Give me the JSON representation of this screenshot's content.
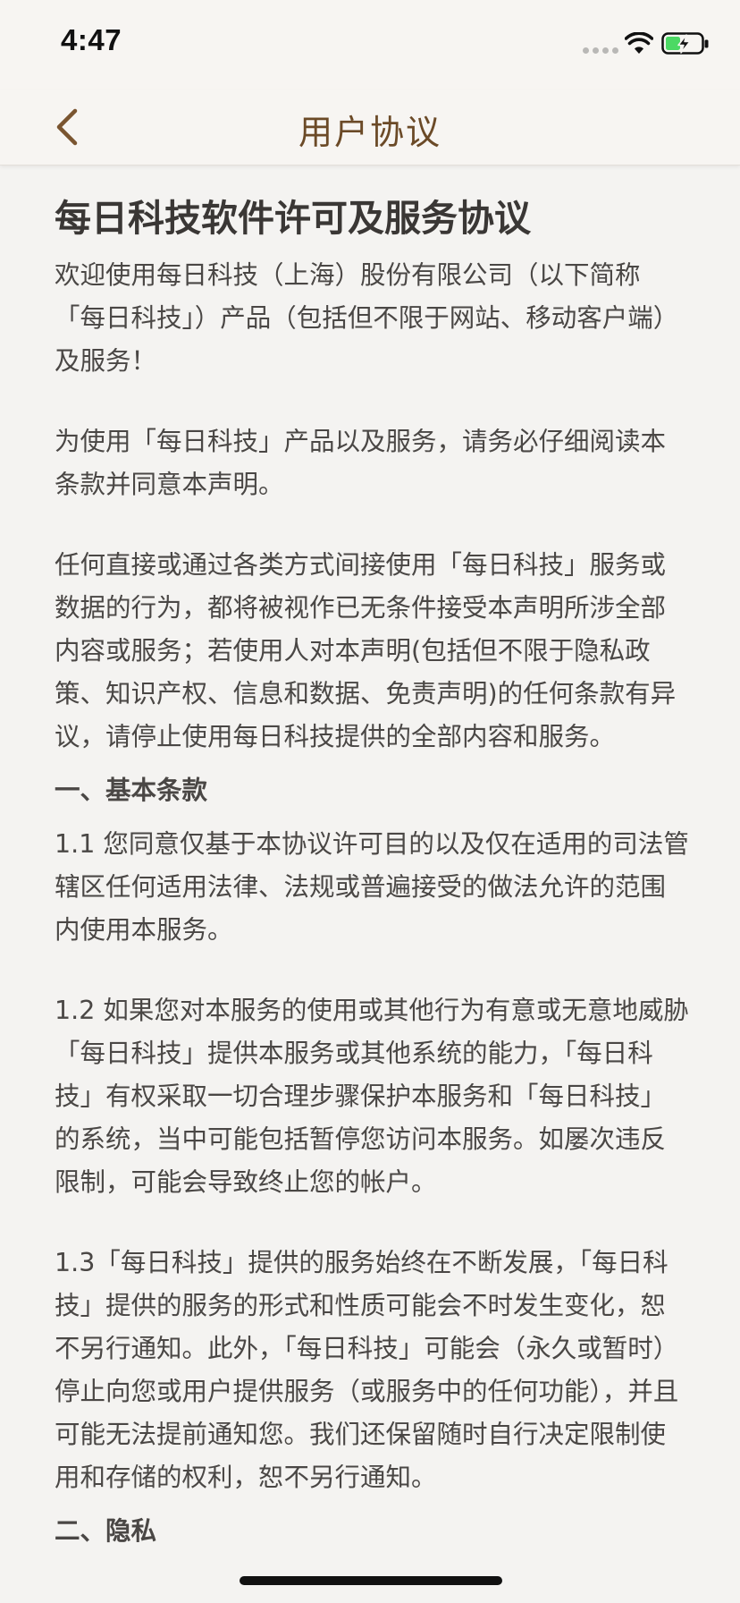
{
  "status_bar": {
    "time": "4:47"
  },
  "nav": {
    "title": "用户协议"
  },
  "document": {
    "title": "每日科技软件许可及服务协议",
    "intro_1": "欢迎使用每日科技（上海）股份有限公司（以下简称「每日科技」）产品（包括但不限于网站、移动客户端）及服务！",
    "intro_2": "为使用「每日科技」产品以及服务，请务必仔细阅读本条款并同意本声明。",
    "intro_3": "任何直接或通过各类方式间接使用「每日科技」服务或数据的行为，都将被视作已无条件接受本声明所涉全部内容或服务；若使用人对本声明(包括但不限于隐私政策、知识产权、信息和数据、免责声明)的任何条款有异议，请停止使用每日科技提供的全部内容和服务。",
    "section_1_heading": "一、基本条款",
    "clause_1_1": "1.1 您同意仅基于本协议许可目的以及仅在适用的司法管辖区任何适用法律、法规或普遍接受的做法允许的范围内使用本服务。",
    "clause_1_2": "1.2 如果您对本服务的使用或其他行为有意或无意地威胁「每日科技」提供本服务或其他系统的能力，「每日科技」有权采取一切合理步骤保护本服务和「每日科技」的系统，当中可能包括暂停您访问本服务。如屡次违反限制，可能会导致终止您的帐户。",
    "clause_1_3": "1.3「每日科技」提供的服务始终在不断发展，「每日科技」提供的服务的形式和性质可能会不时发生变化，恕不另行通知。此外，「每日科技」可能会（永久或暂时）停止向您或用户提供服务（或服务中的任何功能），并且可能无法提前通知您。我们还保留随时自行决定限制使用和存储的权利，恕不另行通知。",
    "section_2_heading": "二、隐私"
  },
  "colors": {
    "nav_title": "#6b4a27",
    "back_icon": "#7a5530",
    "battery_fill": "#4cd964"
  }
}
